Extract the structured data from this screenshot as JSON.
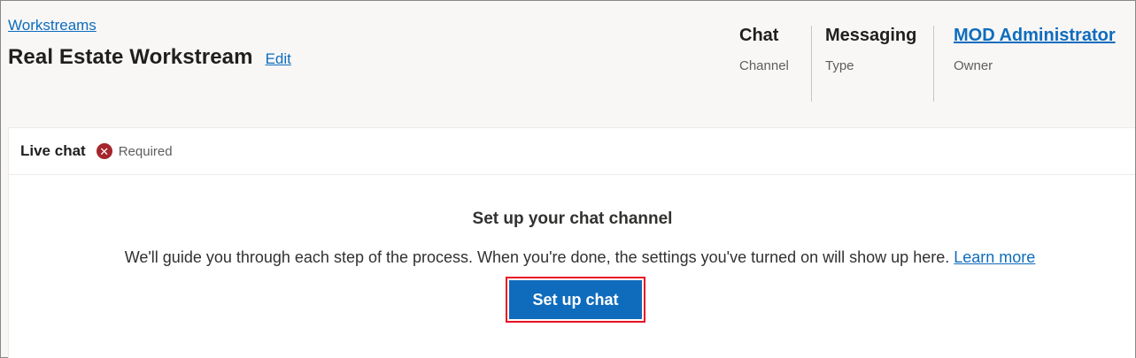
{
  "breadcrumb": {
    "label": "Workstreams"
  },
  "header": {
    "title": "Real Estate Workstream",
    "edit_label": "Edit",
    "meta": [
      {
        "value": "Chat",
        "label": "Channel"
      },
      {
        "value": "Messaging",
        "label": "Type"
      },
      {
        "value": "MOD Administrator",
        "label": "Owner"
      }
    ]
  },
  "card": {
    "title": "Live chat",
    "status_icon": "error-circle-icon",
    "status_icon_glyph": "✕",
    "status_text": "Required",
    "empty_state": {
      "title": "Set up your chat channel",
      "description": "We'll guide you through each step of the process. When you're done, the settings you've turned on will show up here.",
      "link_label": "Learn more",
      "button_label": "Set up chat"
    }
  },
  "colors": {
    "accent": "#0f6cbd",
    "error": "#a4262c",
    "highlight_outline": "#e81123",
    "header_bg": "#f8f7f6"
  }
}
